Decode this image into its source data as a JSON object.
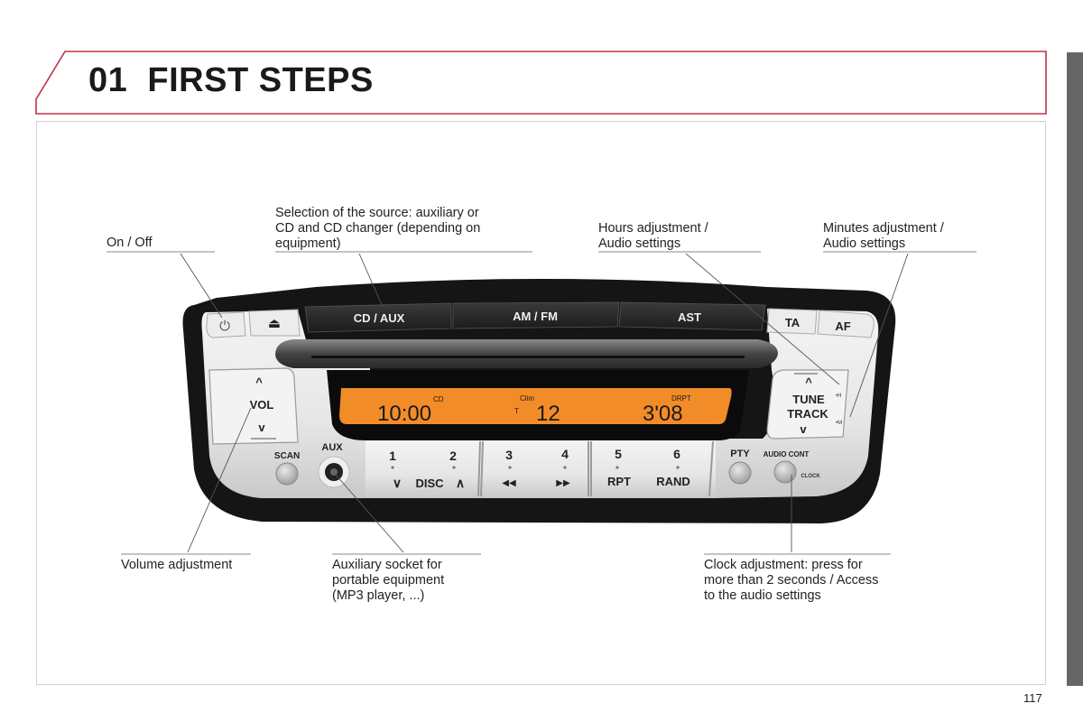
{
  "header": {
    "chapter_number": "01",
    "chapter_title": "FIRST STEPS",
    "accent_color": "#c0304a"
  },
  "page_number": "117",
  "callouts": {
    "on_off": [
      "On / Off"
    ],
    "source": [
      "Selection of the source: auxiliary or",
      "CD and CD changer (depending on",
      "equipment)"
    ],
    "hours": [
      "Hours adjustment /",
      "Audio settings"
    ],
    "minutes": [
      "Minutes adjustment /",
      "Audio settings"
    ],
    "volume": [
      "Volume adjustment"
    ],
    "aux_socket": [
      "Auxiliary socket for",
      "portable equipment",
      "(MP3 player, ...)"
    ],
    "clock": [
      "Clock adjustment: press for",
      "more than 2 seconds / Access",
      "to the audio settings"
    ]
  },
  "radio": {
    "top_buttons": {
      "power_icon": "⏻",
      "eject_icon": "⏏",
      "cd_aux": "CD / AUX",
      "am_fm": "AM / FM",
      "ast": "AST",
      "ta": "TA",
      "af": "AF"
    },
    "display": {
      "time": "10:00",
      "cd_indicator": "CD",
      "clim_indicator": "Clim",
      "t_indicator": "T",
      "temperature": "12",
      "drpt_indicator": "DRPT",
      "track_time": "3'08",
      "background_color": "#f28c28"
    },
    "vol": {
      "up": "^",
      "label": "VOL",
      "down": "v"
    },
    "tune": {
      "up": "^",
      "label1": "TUNE",
      "label2": "TRACK",
      "down": "v",
      "h_mark": "•H",
      "m_mark": "•M"
    },
    "scan": "SCAN",
    "aux": "AUX",
    "presets": [
      {
        "num": "1",
        "sub": "∨"
      },
      {
        "num": "2",
        "sub": "∧"
      },
      {
        "num": "3",
        "sub": "◀◀"
      },
      {
        "num": "4",
        "sub": "▶▶"
      },
      {
        "num": "5",
        "sub": "RPT"
      },
      {
        "num": "6",
        "sub": "RAND"
      }
    ],
    "disc_label": "DISC",
    "pty": "PTY",
    "audio_cont": "AUDIO CONT",
    "clock": "CLOCK"
  }
}
